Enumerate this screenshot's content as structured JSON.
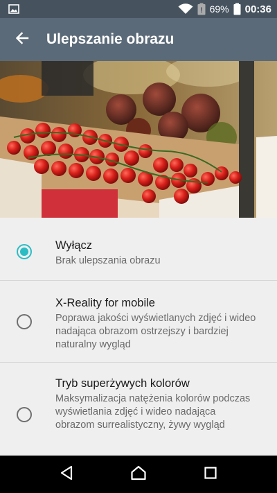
{
  "status_bar": {
    "battery_percent": "69%",
    "time": "00:36",
    "icons": [
      "image-icon",
      "wifi-icon",
      "battery-alert-icon",
      "battery-icon"
    ]
  },
  "app_bar": {
    "title": "Ulepszanie obrazu",
    "back_icon": "arrow-back-icon"
  },
  "hero": {
    "image": "tomatoes-market-photo"
  },
  "options": [
    {
      "title": "Wyłącz",
      "description": "Brak ulepszania obrazu",
      "selected": true
    },
    {
      "title": "X-Reality for mobile",
      "description": "Poprawa jakości wyświetlanych zdjęć i wideo nadająca obrazom ostrzejszy i bardziej naturalny wygląd",
      "selected": false
    },
    {
      "title": "Tryb superżywych kolorów",
      "description": "Maksymalizacja natężenia kolorów podczas wyświetlania zdjęć i wideo nadająca obrazom surrealistyczny, żywy wygląd",
      "selected": false
    }
  ],
  "nav_bar": {
    "buttons": [
      "back-triangle-icon",
      "home-icon",
      "recents-icon"
    ]
  },
  "colors": {
    "status_bar": "#46535f",
    "app_bar": "#5b6a78",
    "accent": "#2cbcc4",
    "background": "#efefef"
  }
}
